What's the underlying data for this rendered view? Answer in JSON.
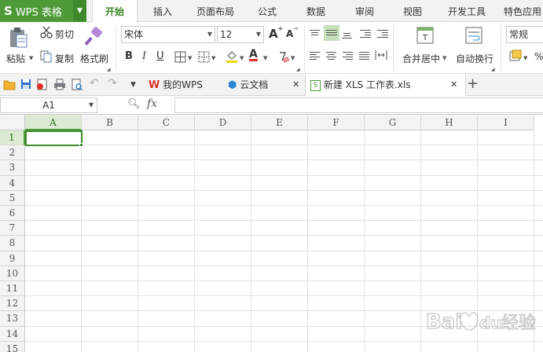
{
  "app": {
    "logo_letter": "S",
    "title": "WPS 表格"
  },
  "menu_tabs": [
    "开始",
    "插入",
    "页面布局",
    "公式",
    "数据",
    "审阅",
    "视图",
    "开发工具",
    "特色应用"
  ],
  "ribbon": {
    "cut": "剪切",
    "copy": "复制",
    "paste": "粘贴",
    "format_painter": "格式刷",
    "font_name": "宋体",
    "font_size": "12",
    "font_grow": "A",
    "font_shrink": "A",
    "bold": "B",
    "italic": "I",
    "underline": "U",
    "font_color_letter": "A",
    "merge_center": "合并居中",
    "wrap_text": "自动换行",
    "number_format": "常规",
    "percent": "%"
  },
  "doc_tabs": [
    {
      "label": "我的WPS"
    },
    {
      "label": "云文档"
    },
    {
      "label": "新建 XLS 工作表.xls"
    }
  ],
  "formula_bar": {
    "cell_ref": "A1",
    "fx": "fx",
    "content": ""
  },
  "sheet": {
    "columns": [
      "A",
      "B",
      "C",
      "D",
      "E",
      "F",
      "G",
      "H",
      "I"
    ],
    "rows": [
      "1",
      "2",
      "3",
      "4",
      "5",
      "6",
      "7",
      "8",
      "9",
      "10",
      "11",
      "12",
      "13",
      "14",
      "15"
    ],
    "selected_cell": "A1"
  },
  "watermark": {
    "text": "Bai",
    "text2": "经验",
    "text3": "du"
  },
  "colors": {
    "brand_green": "#4e9a38",
    "active_tab_text": "#3a8a26",
    "wps_red": "#d9342b",
    "cloud_blue": "#2f86d6"
  }
}
